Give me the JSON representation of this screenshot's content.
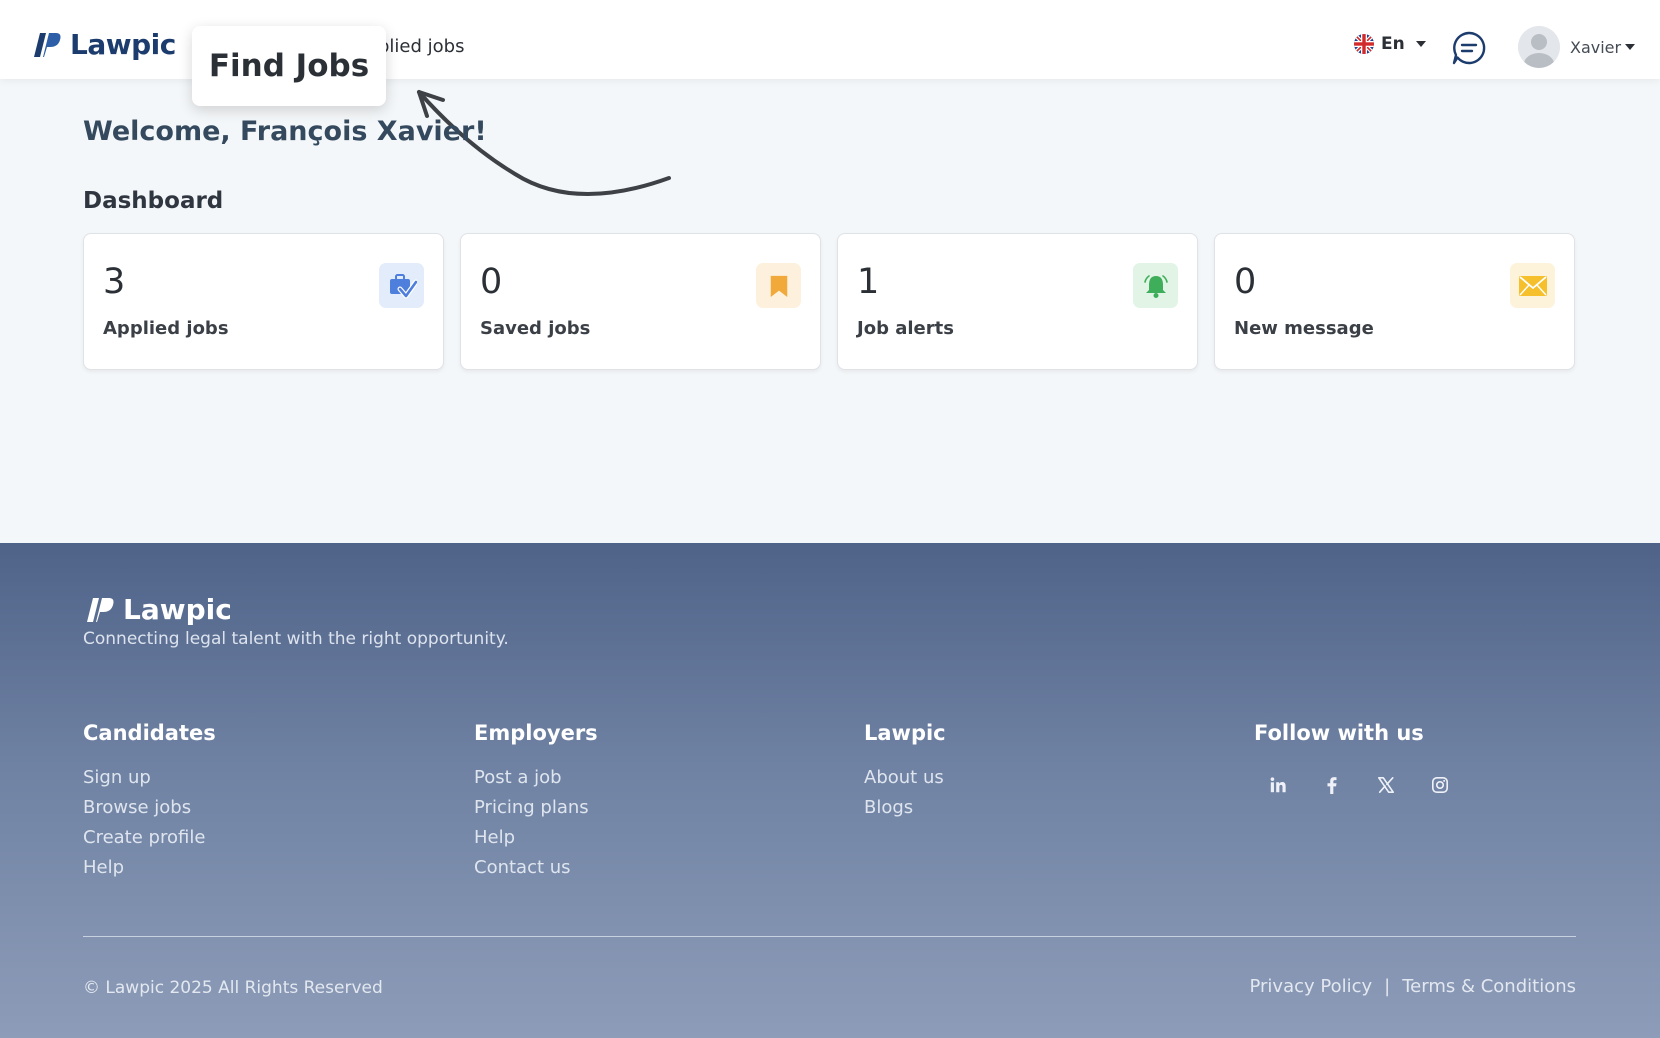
{
  "header": {
    "logo_text": "Lawpic",
    "nav_applied_jobs": "plied jobs",
    "tooltip_label": "Find Jobs",
    "language": "En",
    "user_name": "Xavier"
  },
  "main": {
    "welcome": "Welcome, François Xavier!",
    "dashboard_title": "Dashboard",
    "cards": [
      {
        "count": "3",
        "label": "Applied jobs",
        "icon": "briefcase-check-icon",
        "icon_bg": "#e3ecfb",
        "icon_color": "#4f7fdc"
      },
      {
        "count": "0",
        "label": "Saved jobs",
        "icon": "bookmark-icon",
        "icon_bg": "#fdf1dd",
        "icon_color": "#f2a93b"
      },
      {
        "count": "1",
        "label": "Job alerts",
        "icon": "bell-icon",
        "icon_bg": "#e1f4e6",
        "icon_color": "#3fae5a"
      },
      {
        "count": "0",
        "label": "New message",
        "icon": "envelope-icon",
        "icon_bg": "#fdf3da",
        "icon_color": "#f5c02c"
      }
    ]
  },
  "footer": {
    "logo_text": "Lawpic",
    "tagline": "Connecting legal talent with the right opportunity.",
    "columns": [
      {
        "title": "Candidates",
        "links": [
          "Sign up",
          "Browse jobs",
          "Create profile",
          "Help"
        ]
      },
      {
        "title": "Employers",
        "links": [
          "Post a job",
          "Pricing plans",
          "Help",
          "Contact us"
        ]
      },
      {
        "title": "Lawpic",
        "links": [
          "About us",
          "Blogs"
        ]
      }
    ],
    "follow_title": "Follow with us",
    "socials": [
      "linkedin-icon",
      "facebook-icon",
      "x-icon",
      "instagram-icon"
    ],
    "copyright": "© Lawpic 2025 All Rights Reserved",
    "privacy": "Privacy Policy",
    "separator": "|",
    "terms": "Terms & Conditions"
  }
}
